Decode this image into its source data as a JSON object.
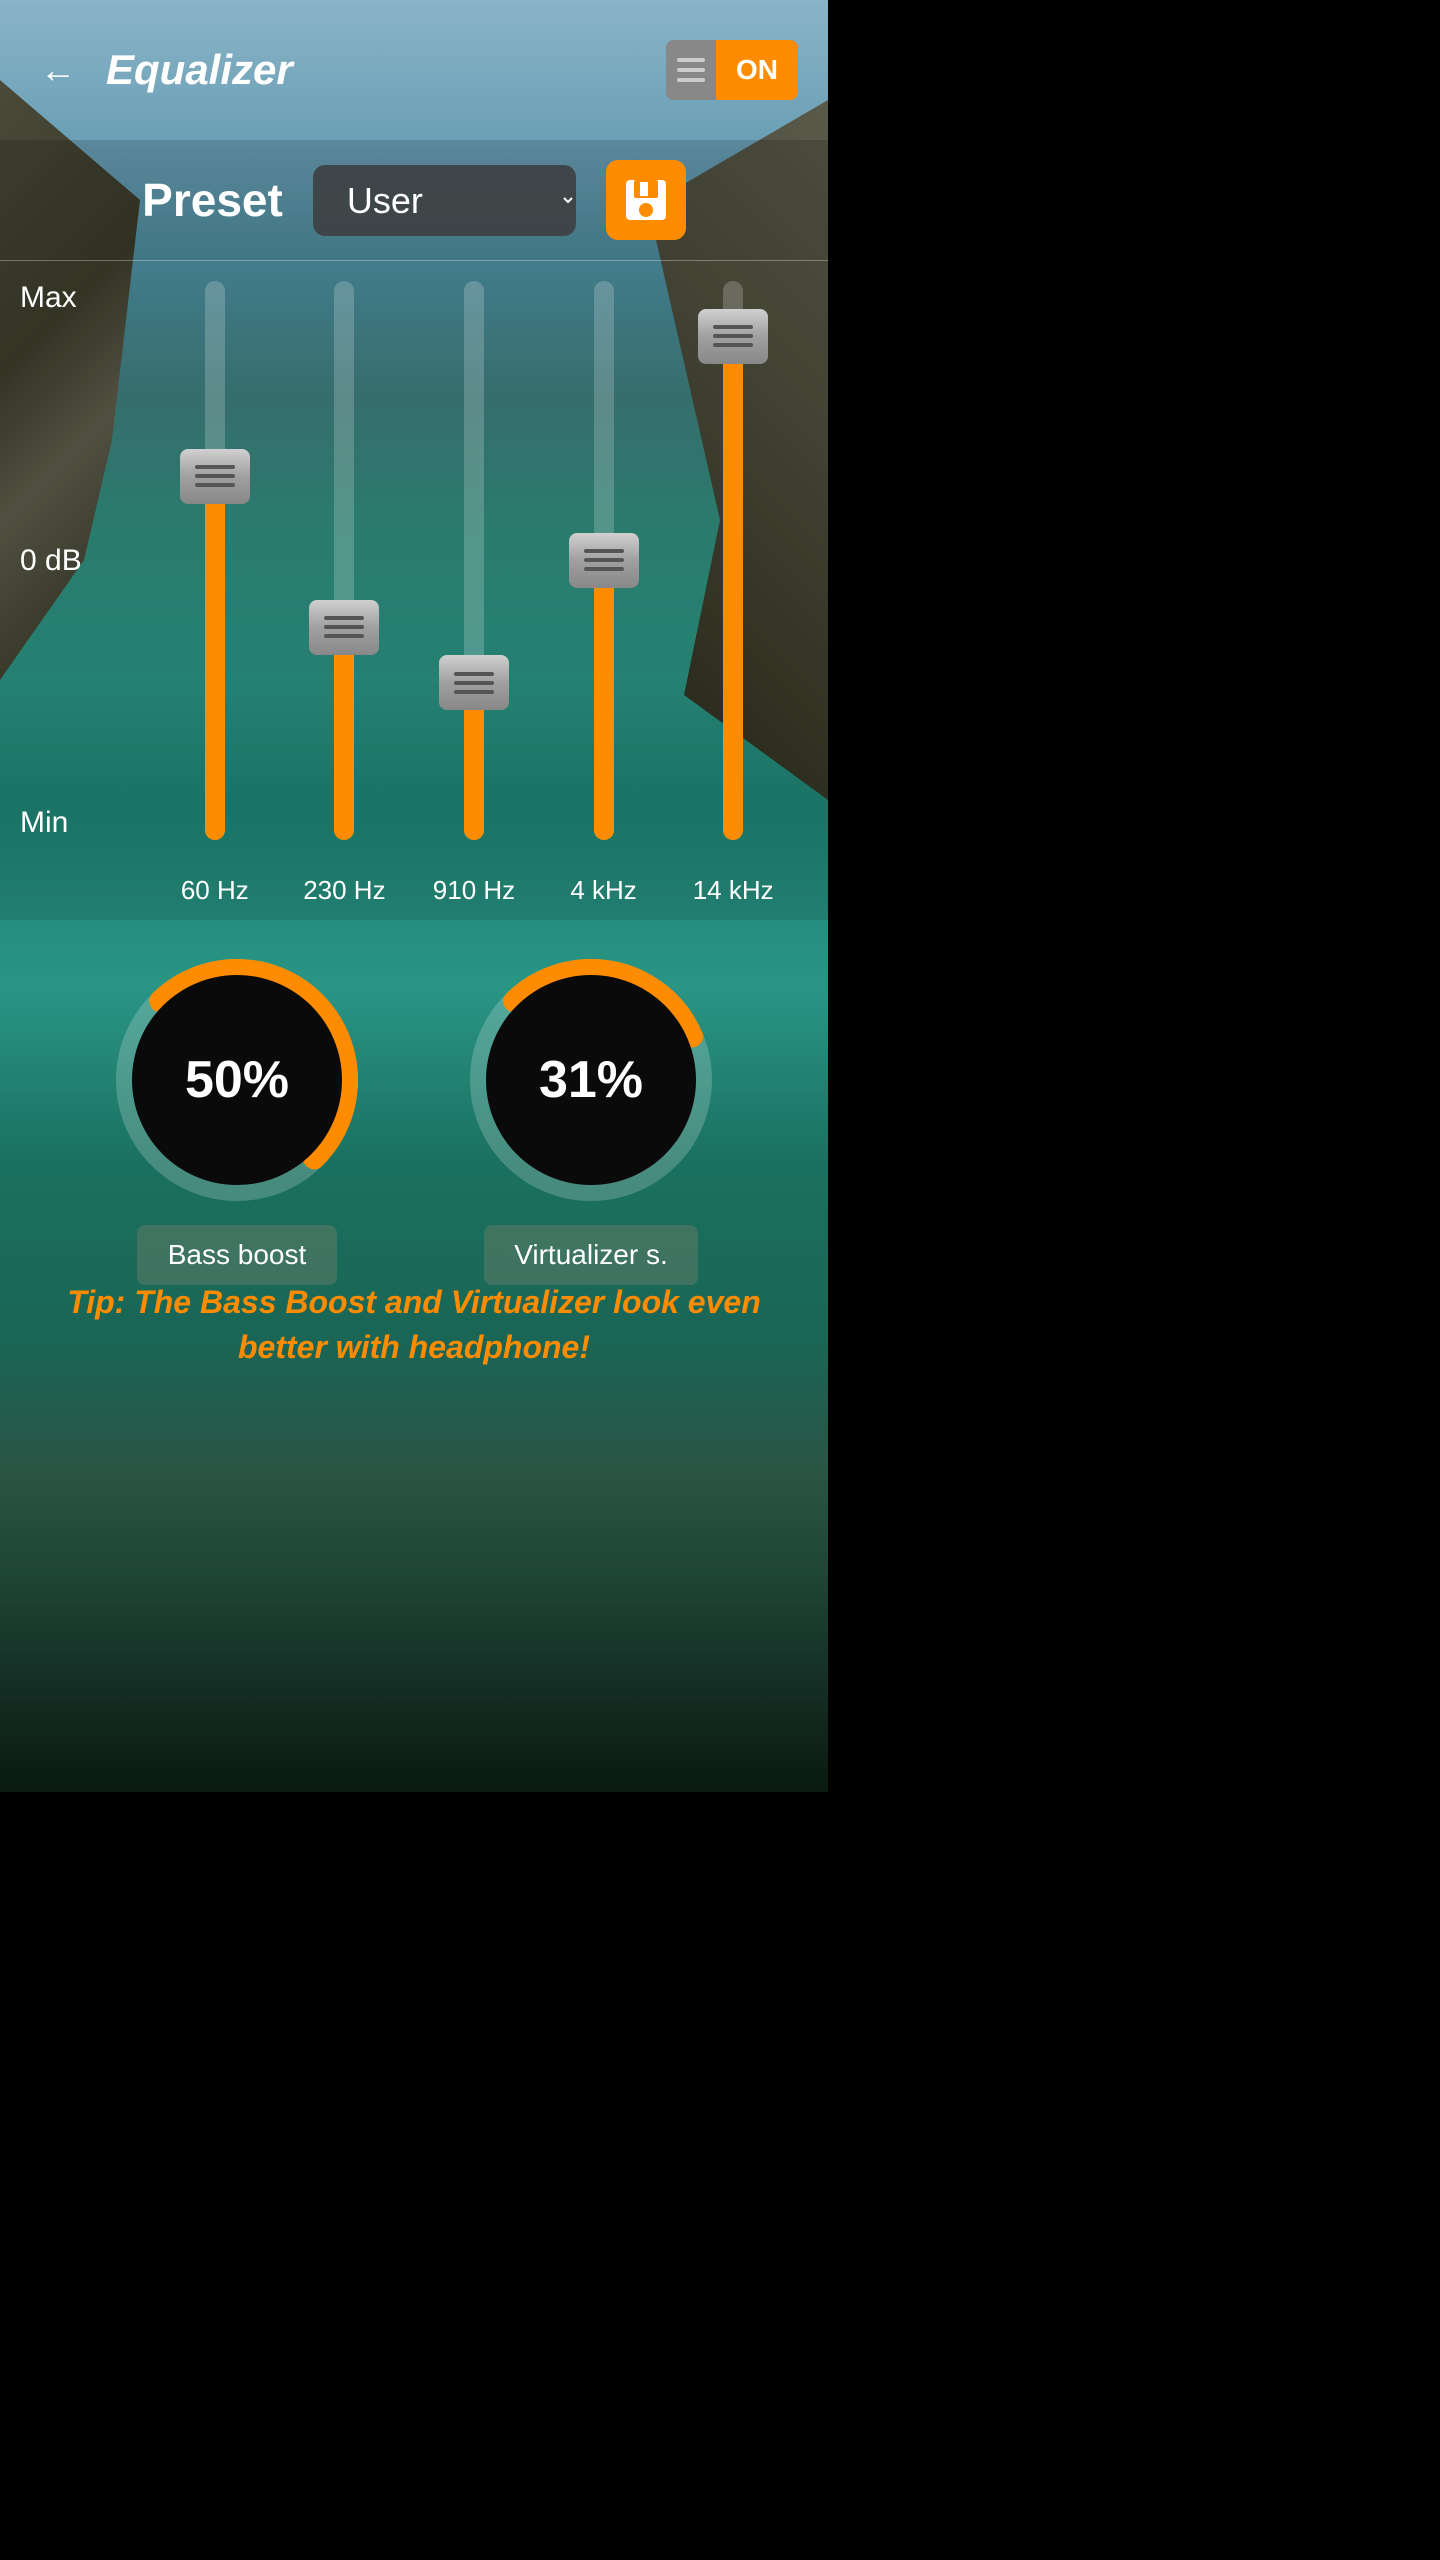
{
  "header": {
    "back_icon": "←",
    "title": "Equalizer",
    "toggle_bars_label": "toggle-bars",
    "toggle_state": "ON"
  },
  "preset": {
    "label": "Preset",
    "current_value": "User",
    "save_icon": "💾"
  },
  "equalizer": {
    "max_label": "Max",
    "zero_label": "0 dB",
    "min_label": "Min",
    "sliders": [
      {
        "freq": "60 Hz",
        "fill_pct": 65,
        "handle_top_pct": 20
      },
      {
        "freq": "230 Hz",
        "fill_pct": 40,
        "handle_top_pct": 48
      },
      {
        "freq": "910 Hz",
        "fill_pct": 30,
        "handle_top_pct": 58
      },
      {
        "freq": "4 kHz",
        "fill_pct": 50,
        "handle_top_pct": 38
      },
      {
        "freq": "14 kHz",
        "fill_pct": 85,
        "handle_top_pct": 5
      }
    ]
  },
  "dials": [
    {
      "label": "Bass boost",
      "percent": "50%",
      "value": 50,
      "color": "#FF8C00"
    },
    {
      "label": "Virtualizer s.",
      "percent": "31%",
      "value": 31,
      "color": "#FF8C00"
    }
  ],
  "tip": {
    "text": "Tip: The Bass Boost and Virtualizer look even better with headphone!"
  }
}
